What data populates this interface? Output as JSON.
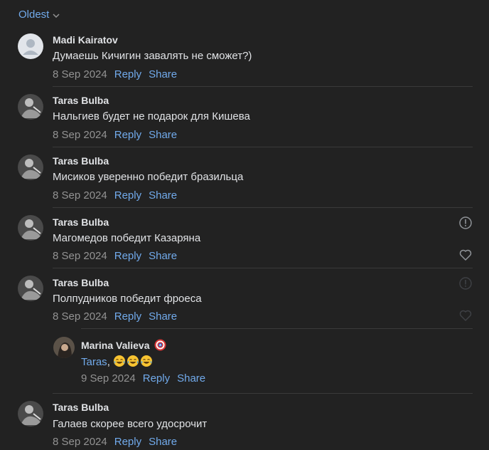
{
  "sort": {
    "label": "Oldest"
  },
  "comments": [
    {
      "author": "Madi Kairatov",
      "text": "Думаешь Кичигин завалять не сможет?)",
      "date": "8 Sep 2024",
      "reply": "Reply",
      "share": "Share"
    },
    {
      "author": "Taras Bulba",
      "text": "Нальгиев будет не подарок для Кишева",
      "date": "8 Sep 2024",
      "reply": "Reply",
      "share": "Share"
    },
    {
      "author": "Taras Bulba",
      "text": "Мисиков уверенно победит бразильца",
      "date": "8 Sep 2024",
      "reply": "Reply",
      "share": "Share"
    },
    {
      "author": "Taras Bulba",
      "text": "Магомедов победит Казаряна",
      "date": "8 Sep 2024",
      "reply": "Reply",
      "share": "Share"
    },
    {
      "author": "Taras Bulba",
      "text": "Полпудников победит фроеса",
      "date": "8 Sep 2024",
      "reply": "Reply",
      "share": "Share"
    },
    {
      "author": "Marina Valieva",
      "mention": "Taras",
      "text_suffix": ", ",
      "date": "9 Sep 2024",
      "reply": "Reply",
      "share": "Share"
    },
    {
      "author": "Taras Bulba",
      "text": "Галаев скорее всего удосрочит",
      "date": "8 Sep 2024",
      "reply": "Reply",
      "share": "Share"
    }
  ],
  "icons": {
    "sort": "chevron-down-icon",
    "report": "report-icon",
    "like": "heart-icon",
    "badge": "captain-shield-emoji",
    "laugh": "face-with-tears-of-joy-emoji"
  },
  "colors": {
    "background": "#222222",
    "text": "#e1e3e6",
    "link": "#71aaeb",
    "muted": "#939393",
    "separator": "#3a3a3a"
  }
}
